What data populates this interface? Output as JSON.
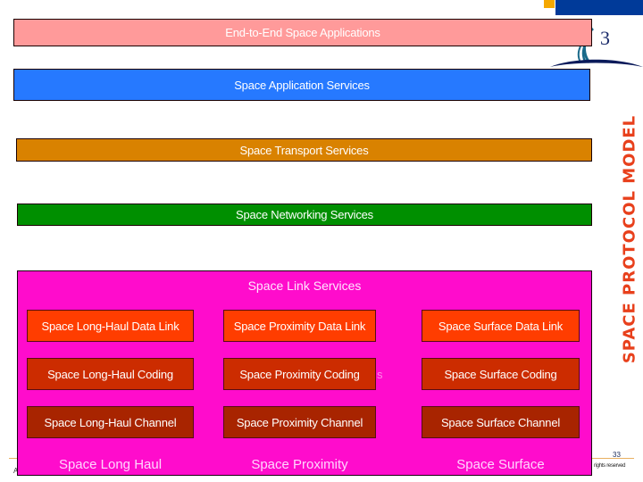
{
  "layers": {
    "end_to_end": "End-to-End Space Applications",
    "application": "Space Application Services",
    "transport": "Space Transport Services",
    "networking": "Space Networking Services"
  },
  "link_services": {
    "title": "Space Link Services",
    "rows": [
      {
        "name": "data-link",
        "cells": [
          "Space Long-Haul Data Link",
          "Space Proximity Data Link",
          "Space Surface Data Link"
        ]
      },
      {
        "name": "coding",
        "cells": [
          "Space Long-Haul Coding",
          "Space Proximity Coding",
          "Space Surface Coding"
        ]
      },
      {
        "name": "channel",
        "cells": [
          "Space Long-Haul Channel",
          "Space Proximity Channel",
          "Space Surface Channel"
        ]
      }
    ],
    "columns": [
      "Space Long Haul",
      "Space Proximity",
      "Space Surface"
    ],
    "ghost_text": "s"
  },
  "side_title": "SPACE PROTOCOL MODEL",
  "logo": {
    "glyph": "3"
  },
  "footer": {
    "page_number": "33",
    "rights": "rights reserved",
    "left_text": "A"
  },
  "colors": {
    "end_to_end": "#ff9a9a",
    "application": "#2679ff",
    "transport": "#d98200",
    "networking": "#008f00",
    "link_services": "#ff0ccc",
    "data_link": "#ff3d00",
    "coding": "#cc2c00",
    "channel": "#a82400",
    "side_title": "#e8401c",
    "logo_blue": "#003a99",
    "logo_orange": "#f5a800"
  }
}
